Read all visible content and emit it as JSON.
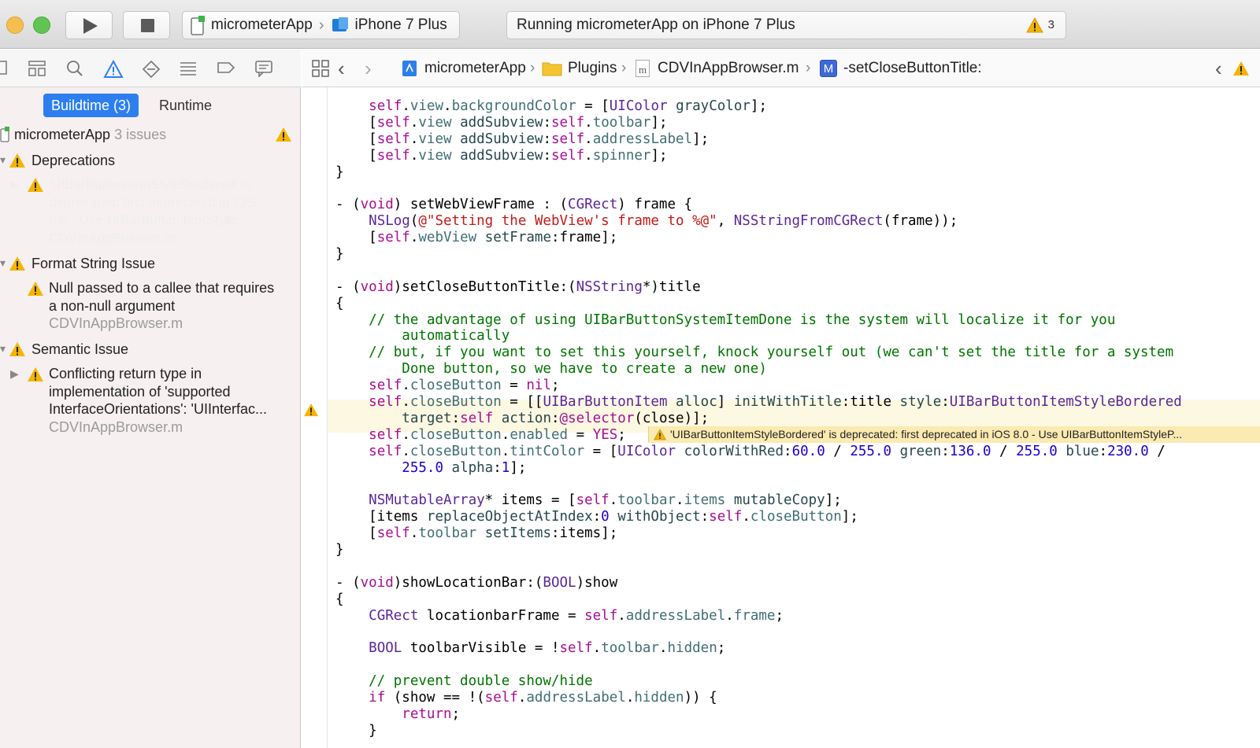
{
  "toolbar": {
    "scheme_app": "micrometerApp",
    "scheme_device": "iPhone 7 Plus",
    "activity_text": "Running micrometerApp on iPhone 7 Plus",
    "warning_count": "3"
  },
  "navigator": {
    "tabs": {
      "buildtime": "Buildtime (3)",
      "runtime": "Runtime"
    },
    "project": {
      "name": "micrometerApp",
      "issues": "3 issues"
    },
    "groups": [
      {
        "label": "Deprecations",
        "issues": [
          {
            "lines": [
              "'UIBarButtonItemStyleBordered' is",
              "deprecated: first deprecated in iOS",
              "8.0 - Use UIBarButtonItemStyle..."
            ],
            "file": "CDVInAppBrowser.m"
          }
        ]
      },
      {
        "label": "Format String Issue",
        "issues": [
          {
            "lines": [
              "Null passed to a callee that requires",
              "a non-null argument"
            ],
            "file": "CDVInAppBrowser.m"
          }
        ]
      },
      {
        "label": "Semantic Issue",
        "issues": [
          {
            "lines": [
              "Conflicting return type in",
              "implementation of 'supported",
              "InterfaceOrientations': 'UIInterfac..."
            ],
            "file": "CDVInAppBrowser.m"
          }
        ]
      }
    ]
  },
  "jumpbar": {
    "project": "micrometerApp",
    "group": "Plugins",
    "file": "CDVInAppBrowser.m",
    "method": "-setCloseButtonTitle:",
    "method_badge": "M",
    "file_badge": "m"
  },
  "editor": {
    "inline_issue": "'UIBarButtonItemStyleBordered' is deprecated: first deprecated in iOS 8.0 - Use UIBarButtonItemStyleP...",
    "lines": [
      [
        [
          "    ",
          ""
        ],
        [
          "self",
          "kw"
        ],
        [
          ".",
          ""
        ],
        [
          "view",
          "pr"
        ],
        [
          ".",
          ""
        ],
        [
          "backgroundColor",
          "pr"
        ],
        [
          " = [",
          ""
        ],
        [
          "UIColor",
          "ty"
        ],
        [
          " ",
          ""
        ],
        [
          "grayColor",
          "me"
        ],
        [
          "];",
          ""
        ]
      ],
      [
        [
          "    [",
          ""
        ],
        [
          "self",
          "kw"
        ],
        [
          ".",
          ""
        ],
        [
          "view",
          "pr"
        ],
        [
          " ",
          ""
        ],
        [
          "addSubview",
          "me"
        ],
        [
          ":",
          ""
        ],
        [
          "self",
          "kw"
        ],
        [
          ".",
          ""
        ],
        [
          "toolbar",
          "pr"
        ],
        [
          "];",
          ""
        ]
      ],
      [
        [
          "    [",
          ""
        ],
        [
          "self",
          "kw"
        ],
        [
          ".",
          ""
        ],
        [
          "view",
          "pr"
        ],
        [
          " ",
          ""
        ],
        [
          "addSubview",
          "me"
        ],
        [
          ":",
          ""
        ],
        [
          "self",
          "kw"
        ],
        [
          ".",
          ""
        ],
        [
          "addressLabel",
          "pr"
        ],
        [
          "];",
          ""
        ]
      ],
      [
        [
          "    [",
          ""
        ],
        [
          "self",
          "kw"
        ],
        [
          ".",
          ""
        ],
        [
          "view",
          "pr"
        ],
        [
          " ",
          ""
        ],
        [
          "addSubview",
          "me"
        ],
        [
          ":",
          ""
        ],
        [
          "self",
          "kw"
        ],
        [
          ".",
          ""
        ],
        [
          "spinner",
          "pr"
        ],
        [
          "];",
          ""
        ]
      ],
      [
        [
          "}",
          ""
        ]
      ],
      [
        [
          "",
          ""
        ]
      ],
      [
        [
          "- (",
          ""
        ],
        [
          "void",
          "kw"
        ],
        [
          ") setWebViewFrame : (",
          ""
        ],
        [
          "CGRect",
          "ty"
        ],
        [
          ") frame {",
          ""
        ]
      ],
      [
        [
          "    ",
          ""
        ],
        [
          "NSLog",
          "ty"
        ],
        [
          "(",
          ""
        ],
        [
          "@\"Setting the WebView's frame to %@\"",
          "st"
        ],
        [
          ", ",
          ""
        ],
        [
          "NSStringFromCGRect",
          "ty"
        ],
        [
          "(frame));",
          ""
        ]
      ],
      [
        [
          "    [",
          ""
        ],
        [
          "self",
          "kw"
        ],
        [
          ".",
          ""
        ],
        [
          "webView",
          "pr"
        ],
        [
          " ",
          ""
        ],
        [
          "setFrame",
          "me"
        ],
        [
          ":frame];",
          ""
        ]
      ],
      [
        [
          "}",
          ""
        ]
      ],
      [
        [
          "",
          ""
        ]
      ],
      [
        [
          "- (",
          ""
        ],
        [
          "void",
          "kw"
        ],
        [
          ")setCloseButtonTitle:(",
          ""
        ],
        [
          "NSString",
          "ty"
        ],
        [
          "*)title",
          ""
        ]
      ],
      [
        [
          "{",
          ""
        ]
      ],
      [
        [
          "    // the advantage of using UIBarButtonSystemItemDone is the system will localize it for you",
          "cm"
        ]
      ],
      [
        [
          "        automatically",
          "cm"
        ]
      ],
      [
        [
          "    // but, if you want to set this yourself, knock yourself out (we can't set the title for a system",
          "cm"
        ]
      ],
      [
        [
          "        Done button, so we have to create a new one)",
          "cm"
        ]
      ],
      [
        [
          "    ",
          ""
        ],
        [
          "self",
          "kw"
        ],
        [
          ".",
          ""
        ],
        [
          "closeButton",
          "pr"
        ],
        [
          " = ",
          ""
        ],
        [
          "nil",
          "kw"
        ],
        [
          ";",
          ""
        ]
      ],
      [
        [
          "    ",
          ""
        ],
        [
          "self",
          "kw"
        ],
        [
          ".",
          ""
        ],
        [
          "closeButton",
          "pr"
        ],
        [
          " = [[",
          ""
        ],
        [
          "UIBarButtonItem",
          "ty"
        ],
        [
          " ",
          ""
        ],
        [
          "alloc",
          "me"
        ],
        [
          "] ",
          ""
        ],
        [
          "initWithTitle",
          "me"
        ],
        [
          ":title ",
          ""
        ],
        [
          "style",
          "me"
        ],
        [
          ":",
          ""
        ],
        [
          "UIBarButtonItemStyleBordered",
          "ty"
        ]
      ],
      [
        [
          "        ",
          ""
        ],
        [
          "target",
          "me"
        ],
        [
          ":",
          ""
        ],
        [
          "self",
          "kw"
        ],
        [
          " ",
          ""
        ],
        [
          "action",
          "me"
        ],
        [
          ":",
          ""
        ],
        [
          "@selector",
          "kw"
        ],
        [
          "(close)];",
          ""
        ]
      ],
      [
        [
          "    ",
          ""
        ],
        [
          "self",
          "kw"
        ],
        [
          ".",
          ""
        ],
        [
          "closeButton",
          "pr"
        ],
        [
          ".",
          ""
        ],
        [
          "enabled",
          "pr"
        ],
        [
          " = ",
          ""
        ],
        [
          "YES",
          "kw"
        ],
        [
          ";",
          ""
        ]
      ],
      [
        [
          "    ",
          ""
        ],
        [
          "self",
          "kw"
        ],
        [
          ".",
          ""
        ],
        [
          "closeButton",
          "pr"
        ],
        [
          ".",
          ""
        ],
        [
          "tintColor",
          "pr"
        ],
        [
          " = [",
          ""
        ],
        [
          "UIColor",
          "ty"
        ],
        [
          " ",
          ""
        ],
        [
          "colorWithRed",
          "me"
        ],
        [
          ":",
          ""
        ],
        [
          "60.0",
          "nu"
        ],
        [
          " / ",
          ""
        ],
        [
          "255.0",
          "nu"
        ],
        [
          " ",
          ""
        ],
        [
          "green",
          "me"
        ],
        [
          ":",
          ""
        ],
        [
          "136.0",
          "nu"
        ],
        [
          " / ",
          ""
        ],
        [
          "255.0",
          "nu"
        ],
        [
          " ",
          ""
        ],
        [
          "blue",
          "me"
        ],
        [
          ":",
          ""
        ],
        [
          "230.0",
          "nu"
        ],
        [
          " /",
          ""
        ]
      ],
      [
        [
          "        ",
          ""
        ],
        [
          "255.0",
          "nu"
        ],
        [
          " ",
          ""
        ],
        [
          "alpha",
          "me"
        ],
        [
          ":",
          ""
        ],
        [
          "1",
          "nu"
        ],
        [
          "];",
          ""
        ]
      ],
      [
        [
          "",
          ""
        ]
      ],
      [
        [
          "    ",
          ""
        ],
        [
          "NSMutableArray",
          "ty"
        ],
        [
          "* items = [",
          ""
        ],
        [
          "self",
          "kw"
        ],
        [
          ".",
          ""
        ],
        [
          "toolbar",
          "pr"
        ],
        [
          ".",
          ""
        ],
        [
          "items",
          "pr"
        ],
        [
          " ",
          ""
        ],
        [
          "mutableCopy",
          "me"
        ],
        [
          "];",
          ""
        ]
      ],
      [
        [
          "    [items ",
          ""
        ],
        [
          "replaceObjectAtIndex",
          "me"
        ],
        [
          ":",
          ""
        ],
        [
          "0",
          "nu"
        ],
        [
          " ",
          ""
        ],
        [
          "withObject",
          "me"
        ],
        [
          ":",
          ""
        ],
        [
          "self",
          "kw"
        ],
        [
          ".",
          ""
        ],
        [
          "closeButton",
          "pr"
        ],
        [
          "];",
          ""
        ]
      ],
      [
        [
          "    [",
          ""
        ],
        [
          "self",
          "kw"
        ],
        [
          ".",
          ""
        ],
        [
          "toolbar",
          "pr"
        ],
        [
          " ",
          ""
        ],
        [
          "setItems",
          "me"
        ],
        [
          ":items];",
          ""
        ]
      ],
      [
        [
          "}",
          ""
        ]
      ],
      [
        [
          "",
          ""
        ]
      ],
      [
        [
          "- (",
          ""
        ],
        [
          "void",
          "kw"
        ],
        [
          ")showLocationBar:(",
          ""
        ],
        [
          "BOOL",
          "ty"
        ],
        [
          ")show",
          ""
        ]
      ],
      [
        [
          "{",
          ""
        ]
      ],
      [
        [
          "    ",
          ""
        ],
        [
          "CGRect",
          "ty"
        ],
        [
          " locationbarFrame = ",
          ""
        ],
        [
          "self",
          "kw"
        ],
        [
          ".",
          ""
        ],
        [
          "addressLabel",
          "pr"
        ],
        [
          ".",
          ""
        ],
        [
          "frame",
          "pr"
        ],
        [
          ";",
          ""
        ]
      ],
      [
        [
          "",
          ""
        ]
      ],
      [
        [
          "    ",
          ""
        ],
        [
          "BOOL",
          "ty"
        ],
        [
          " toolbarVisible = !",
          ""
        ],
        [
          "self",
          "kw"
        ],
        [
          ".",
          ""
        ],
        [
          "toolbar",
          "pr"
        ],
        [
          ".",
          ""
        ],
        [
          "hidden",
          "pr"
        ],
        [
          ";",
          ""
        ]
      ],
      [
        [
          "",
          ""
        ]
      ],
      [
        [
          "    // prevent double show/hide",
          "cm"
        ]
      ],
      [
        [
          "    ",
          ""
        ],
        [
          "if",
          "kw"
        ],
        [
          " (show == !(",
          ""
        ],
        [
          "self",
          "kw"
        ],
        [
          ".",
          ""
        ],
        [
          "addressLabel",
          "pr"
        ],
        [
          ".",
          ""
        ],
        [
          "hidden",
          "pr"
        ],
        [
          ")) {",
          ""
        ]
      ],
      [
        [
          "        ",
          ""
        ],
        [
          "return",
          "kw"
        ],
        [
          ";",
          ""
        ]
      ],
      [
        [
          "    }",
          ""
        ]
      ]
    ]
  }
}
